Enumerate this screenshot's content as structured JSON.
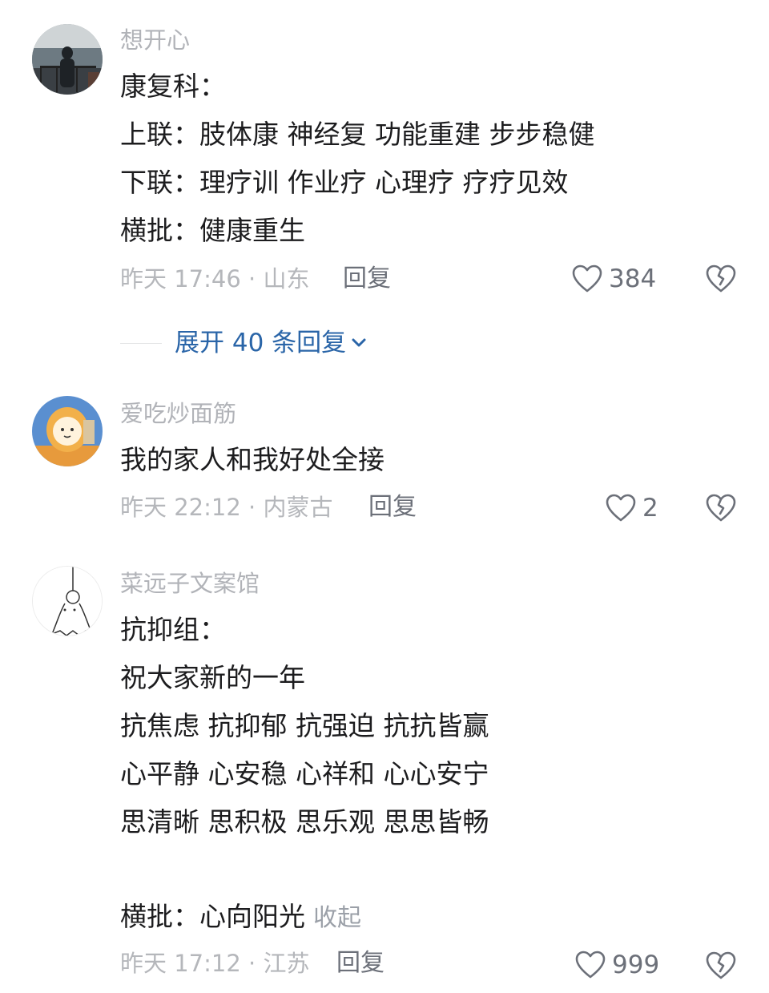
{
  "comments": [
    {
      "username": "想开心",
      "lines": [
        "康复科：",
        "上联：肢体康 神经复 功能重建 步步稳健",
        "下联：理疗训 作业疗 心理疗 疗疗见效",
        "横批：健康重生"
      ],
      "meta": "昨天 17:46 · 山东",
      "reply": "回复",
      "likes": "384",
      "expand": "展开 40 条回复"
    },
    {
      "username": "爱吃炒面筋",
      "lines": [
        "我的家人和我好处全接"
      ],
      "meta": "昨天 22:12 · 内蒙古",
      "reply": "回复",
      "likes": "2"
    },
    {
      "username": "菜远子文案馆",
      "lines": [
        "抗抑组：",
        "祝大家新的一年",
        "抗焦虑 抗抑郁 抗强迫 抗抗皆赢",
        "心平静 心安稳 心祥和 心心安宁",
        "思清晰 思积极 思乐观 思思皆畅",
        "",
        "横批：心向阳光"
      ],
      "collapse": "收起",
      "meta": "昨天 17:12 · 江苏",
      "reply": "回复",
      "likes": "999"
    }
  ],
  "icons": {
    "like": "heart-outline-icon",
    "dislike": "broken-heart-icon",
    "expand": "chevron-down-icon"
  },
  "colors": {
    "accent": "#2a65a8",
    "muted": "#b1b3b8",
    "text": "#1c1c1e"
  }
}
